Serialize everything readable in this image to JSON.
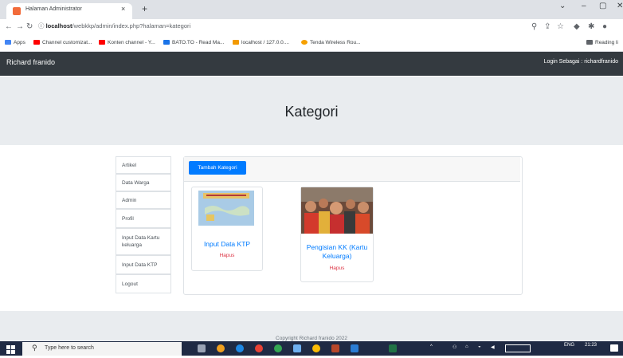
{
  "browser": {
    "tab_title": "Halaman Administrator",
    "tab_close": "×",
    "new_tab": "+",
    "url_host": "localhost",
    "url_path": "/webkkp/admin/index.php?halaman=kategori",
    "bookmarks": [
      {
        "label": "Apps",
        "color": "#4285f4"
      },
      {
        "label": "Channel customizat...",
        "color": "#ff0000"
      },
      {
        "label": "Konten channel - Y...",
        "color": "#ff0000"
      },
      {
        "label": "BATO.TO - Read Ma...",
        "color": "#1a73e8"
      },
      {
        "label": "localhost / 127.0.0....",
        "color": "#f29900"
      },
      {
        "label": "Tenda Wireless Rou...",
        "color": "#f6a000"
      }
    ],
    "reading_list": "Reading li"
  },
  "navbar": {
    "brand": "Richard franido",
    "login_text": "Login Sebagai : richardfranido"
  },
  "header": {
    "title": "Kategori"
  },
  "sidebar": {
    "items": [
      {
        "label": "Artikel"
      },
      {
        "label": "Data Warga"
      },
      {
        "label": "Admin"
      },
      {
        "label": "Profil"
      },
      {
        "label": "Input Data Kartu keluarga"
      },
      {
        "label": "Input Data KTP"
      },
      {
        "label": "Logout"
      }
    ]
  },
  "main": {
    "add_button": "Tambah Kategori",
    "categories": [
      {
        "title": "Input Data KTP",
        "action": "Hapus"
      },
      {
        "title": "Pengisian KK (Kartu Keluarga)",
        "action": "Hapus"
      }
    ]
  },
  "footer": {
    "copyright": "Copyright Richard franido 2022"
  },
  "taskbar": {
    "search_placeholder": "Type here to search",
    "lang": "ENG",
    "time": "21:23"
  },
  "colors": {
    "primary": "#007bff",
    "danger": "#dc3545",
    "navbar": "#343a40"
  }
}
